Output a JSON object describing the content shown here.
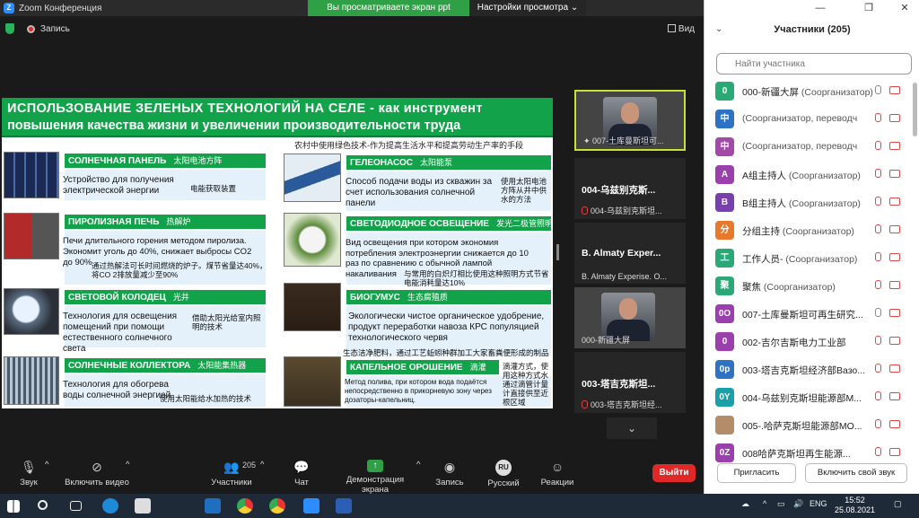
{
  "window": {
    "title": "Zoom Конференция",
    "banner_viewing": "Вы просматриваете экран ppt",
    "banner_options": "Настройки просмотра",
    "rec_label": "Запись",
    "view_label": "Вид"
  },
  "slide": {
    "title_line1": "ИСПОЛЬЗОВАНИЕ ЗЕЛЕНЫХ ТЕХНОЛОГИЙ НА СЕЛЕ - как инструмент",
    "title_line2": "повышения качества жизни и увеличении производительности труда",
    "subtitle_zh": "农村中使用绿色技术-作为提高生活水平和提高劳动生产率的手段",
    "items": [
      {
        "head": "СОЛНЕЧНАЯ ПАНЕЛЬ",
        "head_zh": "太阳电池方阵",
        "text": "Устройство для получения электрической энергии",
        "zh": "电能获取装置"
      },
      {
        "head": "ПИРОЛИЗНАЯ ПЕЧЬ",
        "head_zh": "热解炉",
        "text": "Печи длительного горения методом пиролиза. Экономит уголь до 40%, снижает выбросы CO2 до 90%",
        "zh": "通过热解法可长时间燃烧的炉子。煤节省量达40%，将CO 2排放量减少至90%"
      },
      {
        "head": "СВЕТОВОЙ КОЛОДЕЦ",
        "head_zh": "光井",
        "text": "Технология для освещения помещений при помощи естественного солнечного света",
        "zh": "借助太阳光给室内照明的技术"
      },
      {
        "head": "СОЛНЕЧНЫЕ КОЛЛЕКТОРА",
        "head_zh": "太阳能集热器",
        "text": "Технология для обогрева воды солнечной энергией",
        "zh": "使用太阳能给水加热的技术"
      },
      {
        "head": "ГЕЛЕОНАСОС",
        "head_zh": "太阳能泵",
        "text": "Способ подачи воды из скважин за счет использования солнечной панели",
        "zh": "使用太阳电池方阵从井中供水的方法"
      },
      {
        "head": "СВЕТОДИОДНОЕ ОСВЕЩЕНИЕ",
        "head_zh": "发光二极管照明",
        "text": "Вид освещения при котором экономия потребления электроэнергии снижается до 10 раз по сравнению с обычной лампой накаливания",
        "zh": "与常用的白炽灯相比使用这种照明方式节省电能消耗量达10%"
      },
      {
        "head": "БИОГУМУС",
        "head_zh": "生态腐殖质",
        "text": "Экологически чистое органическое удобрение, продукт переработки навоза КРС популяцией технологического червя",
        "zh": "生态洁净肥料，通过工艺蚯蚓种群加工大家畜粪便形成的制品"
      },
      {
        "head": "КАПЕЛЬНОЕ ОРОШЕНИЕ",
        "head_zh": "滴灌",
        "text": "Метод полива, при котором вода подаётся непосредственно в прикорневую зону через дозаторы-капельниц.",
        "zh": "滴灌方式，使用这种方式水通过滴管计量计直接供至近根区域"
      }
    ]
  },
  "tiles": [
    {
      "name": "",
      "sub": "007-土库曼斯坦可..."
    },
    {
      "name": "004-乌兹别克斯...",
      "sub": "004-乌兹别克斯坦..."
    },
    {
      "name": "B. Almaty Exper...",
      "sub": "B. Almaty Experise. O..."
    },
    {
      "name": "",
      "sub": "000-新疆大屏"
    },
    {
      "name": "003-塔吉克斯坦...",
      "sub": "003-塔吉克斯坦经..."
    }
  ],
  "toolbar": {
    "audio": "Звук",
    "video": "Включить видео",
    "participants": "Участники",
    "participants_count": "205",
    "chat": "Чат",
    "share": "Демонстрация экрана",
    "record": "Запись",
    "language": "Русский",
    "language_badge": "RU",
    "reactions": "Реакции",
    "leave": "Выйти"
  },
  "panel": {
    "title": "Участники (205)",
    "search_placeholder": "Найти участника",
    "invite": "Пригласить",
    "unmute_me": "Включить свой звук",
    "participants": [
      {
        "initial": "0",
        "color": "#2aa876",
        "name": "000-新疆大屏",
        "role": " (Соорганизатор)",
        "mic": "on"
      },
      {
        "initial": "中",
        "color": "#2d72c4",
        "name": "",
        "role": "(Соорганизатор, переводч",
        "mic": "off"
      },
      {
        "initial": "中",
        "color": "#a34aa8",
        "name": "",
        "role": "(Соорганизатор, переводч",
        "mic": "off"
      },
      {
        "initial": "A",
        "color": "#9c3fae",
        "name": "A组主持人",
        "role": " (Соорганизатор)",
        "mic": "off"
      },
      {
        "initial": "B",
        "color": "#7a3fae",
        "name": "B组主持人",
        "role": " (Соорганизатор)",
        "mic": "off"
      },
      {
        "initial": "分",
        "color": "#e8792b",
        "name": "分组主持",
        "role": " (Соорганизатор)",
        "mic": "off"
      },
      {
        "initial": "工",
        "color": "#2aa876",
        "name": "工作人员-",
        "role": " (Соорганизатор)",
        "mic": "off"
      },
      {
        "initial": "聚",
        "color": "#2aa876",
        "name": "聚焦",
        "role": " (Соорганизатор)",
        "mic": "off"
      },
      {
        "initial": "0O",
        "color": "#9c3fae",
        "name": "007-土库曼斯坦可再生研究...",
        "role": "",
        "mic": "on"
      },
      {
        "initial": "0",
        "color": "#9c3fae",
        "name": "002-吉尔吉斯电力工业部",
        "role": "",
        "mic": "off"
      },
      {
        "initial": "0p",
        "color": "#2d72c4",
        "name": "003-塔吉克斯坦经济部Вазо...",
        "role": "",
        "mic": "off"
      },
      {
        "initial": "0Y",
        "color": "#1aa0a8",
        "name": "004-乌兹别克斯坦能源部M...",
        "role": "",
        "mic": "off"
      },
      {
        "initial": "",
        "color": "#b58c6a",
        "name": "005-.哈萨克斯坦能源部MO...",
        "role": "",
        "mic": "off"
      },
      {
        "initial": "0Z",
        "color": "#9c3fae",
        "name": "008哈萨克斯坦再生能源...",
        "role": "",
        "mic": "off"
      }
    ]
  },
  "taskbar": {
    "lang": "ENG",
    "time": "15:52",
    "date": "25.08.2021"
  }
}
